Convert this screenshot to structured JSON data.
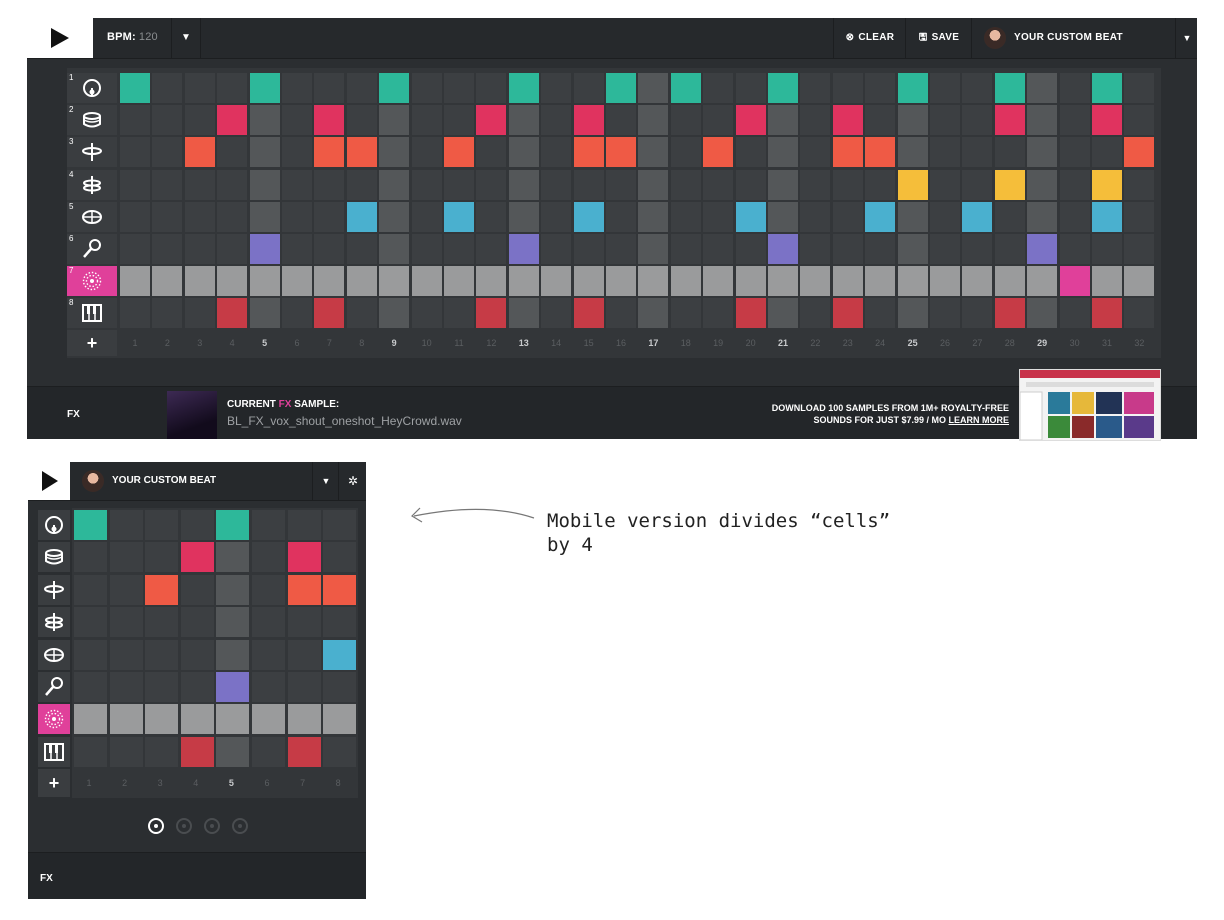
{
  "desktop": {
    "bpm_label": "BPM:",
    "bpm_value": "120",
    "clear_label": "CLEAR",
    "save_label": "SAVE",
    "beat_name": "YOUR CUSTOM BEAT",
    "add_symbol": "+",
    "column_numbers": [
      "1",
      "2",
      "3",
      "4",
      "5",
      "6",
      "7",
      "8",
      "9",
      "10",
      "11",
      "12",
      "13",
      "14",
      "15",
      "16",
      "17",
      "18",
      "19",
      "20",
      "21",
      "22",
      "23",
      "24",
      "25",
      "26",
      "27",
      "28",
      "29",
      "30",
      "31",
      "32"
    ],
    "bold_columns": [
      5,
      9,
      13,
      17,
      21,
      25,
      29
    ],
    "rows": [
      {
        "num": "1",
        "icon": "kick-drum-icon",
        "color": "#2db89a",
        "active_steps": [
          1,
          5,
          9,
          13,
          16,
          18,
          21,
          25,
          28,
          31
        ]
      },
      {
        "num": "2",
        "icon": "snare-drum-icon",
        "color": "#e0335f",
        "active_steps": [
          4,
          7,
          12,
          15,
          20,
          23,
          28,
          31
        ]
      },
      {
        "num": "3",
        "icon": "hihat-icon",
        "color": "#ef5a45",
        "active_steps": [
          3,
          7,
          8,
          11,
          15,
          16,
          19,
          23,
          24,
          32
        ]
      },
      {
        "num": "4",
        "icon": "cymbal-icon",
        "color": "#f5be3a",
        "active_steps": [
          25,
          28,
          31
        ]
      },
      {
        "num": "5",
        "icon": "tom-drum-icon",
        "color": "#4ab0cf",
        "active_steps": [
          8,
          11,
          15,
          20,
          24,
          27,
          31
        ]
      },
      {
        "num": "6",
        "icon": "microphone-icon",
        "color": "#7b72c6",
        "active_steps": [
          5,
          13,
          21,
          29
        ]
      },
      {
        "num": "7",
        "icon": "fx-burst-icon",
        "color": "#e0409a",
        "active_steps": [
          30
        ],
        "highlighted": true
      },
      {
        "num": "8",
        "icon": "piano-keys-icon",
        "color": "#c63b46",
        "active_steps": [
          4,
          7,
          12,
          15,
          20,
          23,
          28,
          31
        ]
      }
    ],
    "fx": {
      "label": "FX",
      "current_prefix": "CURRENT",
      "current_fx_word": "FX",
      "current_suffix": "SAMPLE:",
      "filename": "BL_FX_vox_shout_oneshot_HeyCrowd.wav",
      "ad_line1": "DOWNLOAD 100 SAMPLES FROM 1M+ ROYALTY-FREE",
      "ad_line2": "SOUNDS FOR JUST $7.99 / MO",
      "ad_link": "LEARN MORE"
    }
  },
  "mobile": {
    "beat_name": "YOUR CUSTOM BEAT",
    "add_symbol": "+",
    "column_numbers": [
      "1",
      "2",
      "3",
      "4",
      "5",
      "6",
      "7",
      "8"
    ],
    "bold_columns": [
      5
    ],
    "pages": 4,
    "current_page": 1,
    "fx_label": "FX",
    "rows": [
      {
        "icon": "kick-drum-icon",
        "color": "#2db89a",
        "active_steps": [
          1,
          5
        ]
      },
      {
        "icon": "snare-drum-icon",
        "color": "#e0335f",
        "active_steps": [
          4,
          7
        ]
      },
      {
        "icon": "hihat-icon",
        "color": "#ef5a45",
        "active_steps": [
          3,
          7,
          8
        ]
      },
      {
        "icon": "cymbal-icon",
        "color": "#f5be3a",
        "active_steps": []
      },
      {
        "icon": "tom-drum-icon",
        "color": "#4ab0cf",
        "active_steps": [
          8
        ]
      },
      {
        "icon": "microphone-icon",
        "color": "#7b72c6",
        "active_steps": [
          5
        ]
      },
      {
        "icon": "fx-burst-icon",
        "color": "#e0409a",
        "active_steps": [],
        "highlighted": true
      },
      {
        "icon": "piano-keys-icon",
        "color": "#c63b46",
        "active_steps": [
          4,
          7
        ]
      }
    ]
  },
  "annotation": {
    "text": "Mobile version divides “cells”\nby 4"
  }
}
